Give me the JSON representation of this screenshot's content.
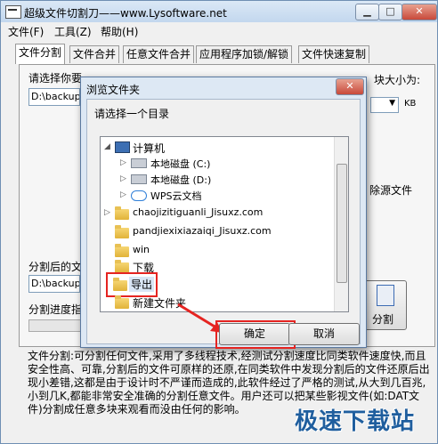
{
  "window": {
    "title": "超级文件切割刀——www.Lysoftware.net",
    "buttons": {
      "minimize": "▁",
      "maximize": "□",
      "close": "✕"
    }
  },
  "menu": [
    "文件(F)",
    "工具(Z)",
    "帮助(H)"
  ],
  "tabs": [
    "文件分割",
    "文件合并",
    "任意文件合并",
    "应用程序加锁/解锁",
    "文件快速复制"
  ],
  "panel": {
    "select_label": "请选择你要",
    "block_size_label": "块大小为:",
    "source_path": "D:\\backup",
    "unit": "KB",
    "delete_source_label": "除源文件",
    "output_label": "分割后的文",
    "output_path": "D:\\backup",
    "progress_label": "分割进度指",
    "split_button": "分割"
  },
  "description": "文件分割:可分割任何文件,采用了多线程技术,经测试分割速度比同类软件速度快,而且安全性高、可靠,分割后的文件可原样的还原,在同类软件中发现分割后的文件还原后出现小差错,这都是由于设计时不严谨而造成的,此软件经过了严格的测试,从大到几百兆,小到几K,都能非常安全准确的分割任意文件。用户还可以把某些影视文件(如:DAT文件)分割成任意多块来观看而没由任何的影响。",
  "watermark": "极速下载站",
  "dialog": {
    "title": "浏览文件夹",
    "prompt": "请选择一个目录",
    "close": "✕",
    "tree": [
      {
        "label": "计算机",
        "icon": "computer-icon",
        "level": 0,
        "arrow": "◢"
      },
      {
        "label": "本地磁盘 (C:)",
        "icon": "drive-icon",
        "level": 1,
        "arrow": "▷"
      },
      {
        "label": "本地磁盘 (D:)",
        "icon": "drive-icon",
        "level": 1,
        "arrow": "▷"
      },
      {
        "label": "WPS云文档",
        "icon": "cloud-icon",
        "level": 1,
        "arrow": "▷"
      },
      {
        "label": "chaojizitiguanli_Jisuxz.com",
        "icon": "folder-icon",
        "level": 0,
        "arrow": "▷"
      },
      {
        "label": "pandjiexixiazaiqi_Jisuxz.com",
        "icon": "folder-icon",
        "level": 0,
        "arrow": ""
      },
      {
        "label": "win",
        "icon": "folder-icon",
        "level": 0,
        "arrow": ""
      },
      {
        "label": "下载",
        "icon": "folder-icon",
        "level": 0,
        "arrow": ""
      },
      {
        "label": "导出",
        "icon": "folder-icon",
        "level": 0,
        "arrow": "",
        "selected": true
      },
      {
        "label": "新建文件夹",
        "icon": "folder-icon",
        "level": 0,
        "arrow": ""
      }
    ],
    "ok": "确定",
    "cancel": "取消"
  },
  "colors": {
    "highlight": "#e52421",
    "accent": "#1f5e9e"
  }
}
